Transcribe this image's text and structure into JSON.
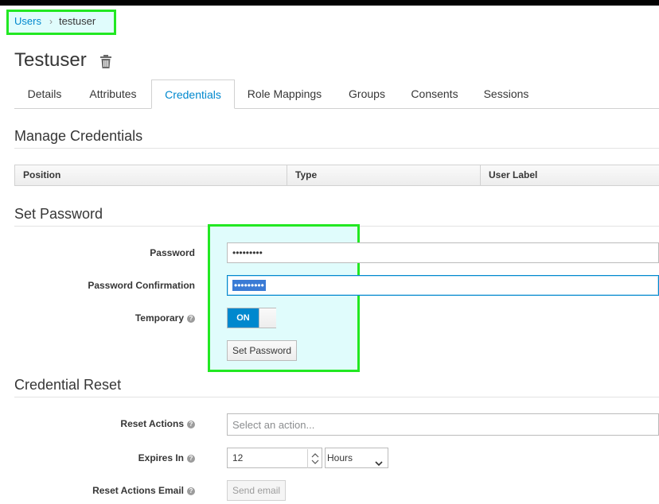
{
  "breadcrumb": {
    "parent": "Users",
    "separator": "›",
    "current": "testuser"
  },
  "page": {
    "title": "Testuser"
  },
  "tabs": [
    {
      "label": "Details"
    },
    {
      "label": "Attributes"
    },
    {
      "label": "Credentials"
    },
    {
      "label": "Role Mappings"
    },
    {
      "label": "Groups"
    },
    {
      "label": "Consents"
    },
    {
      "label": "Sessions"
    }
  ],
  "manage": {
    "title": "Manage Credentials",
    "columns": [
      "Position",
      "Type",
      "User Label"
    ]
  },
  "set_password": {
    "title": "Set Password",
    "password_label": "Password",
    "password_value": "•••••••••",
    "confirm_label": "Password Confirmation",
    "confirm_value": "•••••••••",
    "temporary_label": "Temporary",
    "temporary_state": "ON",
    "submit_label": "Set Password"
  },
  "credential_reset": {
    "title": "Credential Reset",
    "actions_label": "Reset Actions",
    "actions_placeholder": "Select an action...",
    "expires_label": "Expires In",
    "expires_value": "12",
    "expires_unit": "Hours",
    "email_label": "Reset Actions Email",
    "email_button": "Send email"
  },
  "colors": {
    "accent": "#0088ce",
    "highlight": "#22e822",
    "toggle_on": "#0088ce"
  }
}
